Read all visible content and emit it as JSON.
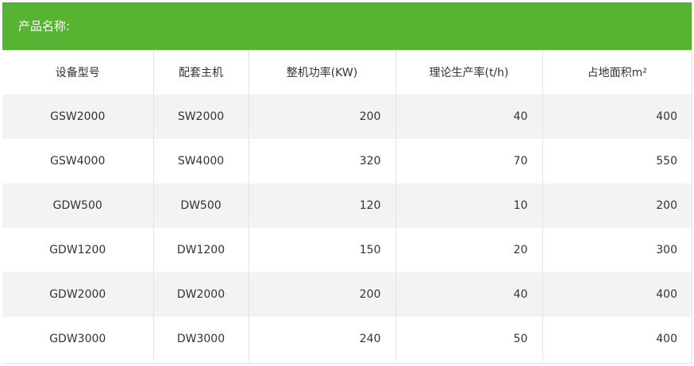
{
  "title": "产品名称:",
  "columns": [
    "设备型号",
    "配套主机",
    "整机功率(KW)",
    "理论生产率(t/h)",
    "占地面积m²"
  ],
  "rows": [
    [
      "GSW2000",
      "SW2000",
      "200",
      "40",
      "400"
    ],
    [
      "GSW4000",
      "SW4000",
      "320",
      "70",
      "550"
    ],
    [
      "GDW500",
      "DW500",
      "120",
      "10",
      "200"
    ],
    [
      "GDW1200",
      "DW1200",
      "150",
      "20",
      "300"
    ],
    [
      "GDW2000",
      "DW2000",
      "200",
      "40",
      "400"
    ],
    [
      "GDW3000",
      "DW3000",
      "240",
      "50",
      "400"
    ]
  ],
  "colors": {
    "header_bar": "#56b432",
    "row_alt": "#f3f3f3",
    "text": "#333333"
  }
}
